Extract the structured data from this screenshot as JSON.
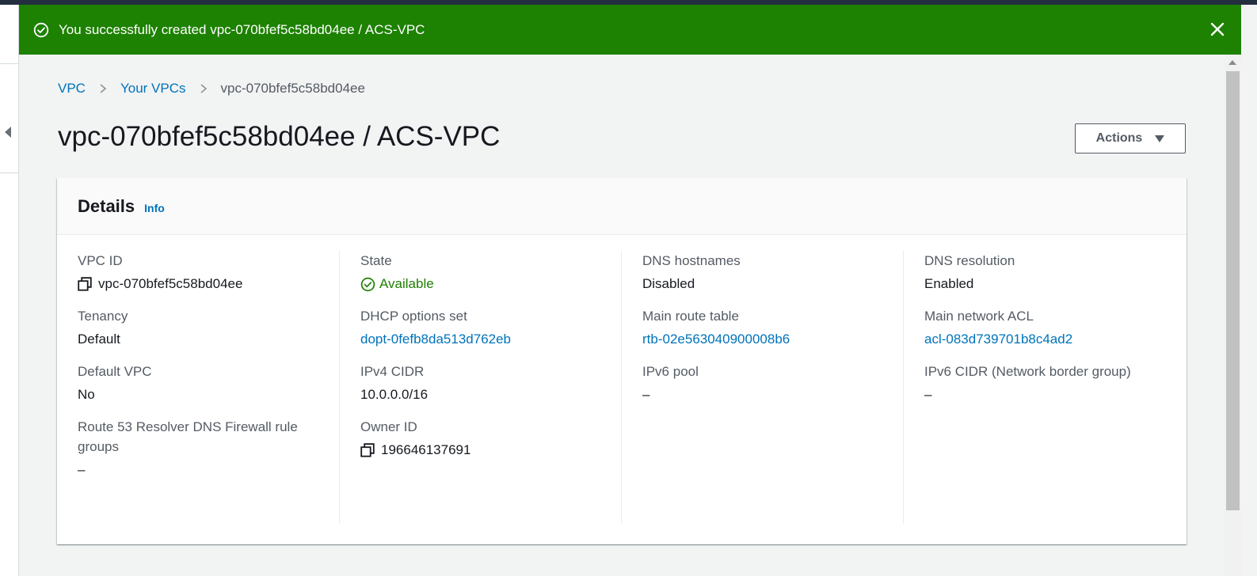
{
  "flash": {
    "message": "You successfully created vpc-070bfef5c58bd04ee / ACS-VPC"
  },
  "breadcrumb": {
    "items": [
      "VPC",
      "Your VPCs"
    ],
    "current": "vpc-070bfef5c58bd04ee"
  },
  "page": {
    "title": "vpc-070bfef5c58bd04ee / ACS-VPC",
    "actions_label": "Actions"
  },
  "details": {
    "title": "Details",
    "info_label": "Info",
    "columns": [
      [
        {
          "label": "VPC ID",
          "value": "vpc-070bfef5c58bd04ee"
        },
        {
          "label": "Tenancy",
          "value": "Default"
        },
        {
          "label": "Default VPC",
          "value": "No"
        },
        {
          "label": "Route 53 Resolver DNS Firewall rule groups",
          "value": "–"
        }
      ],
      [
        {
          "label": "State",
          "value": "Available"
        },
        {
          "label": "DHCP options set",
          "value": "dopt-0fefb8da513d762eb"
        },
        {
          "label": "IPv4 CIDR",
          "value": "10.0.0.0/16"
        },
        {
          "label": "Owner ID",
          "value": "196646137691"
        }
      ],
      [
        {
          "label": "DNS hostnames",
          "value": "Disabled"
        },
        {
          "label": "Main route table",
          "value": "rtb-02e563040900008b6"
        },
        {
          "label": "IPv6 pool",
          "value": "–"
        }
      ],
      [
        {
          "label": "DNS resolution",
          "value": "Enabled"
        },
        {
          "label": "Main network ACL",
          "value": "acl-083d739701b8c4ad2"
        },
        {
          "label": "IPv6 CIDR (Network border group)",
          "value": "–"
        }
      ]
    ]
  },
  "colors": {
    "success": "#1d8102",
    "link": "#0073bb",
    "header": "#232f3e"
  },
  "icons": [
    "status-ok-icon",
    "close-icon",
    "chevron-right-icon",
    "caret-down-icon",
    "copy-icon",
    "collapse-left-icon"
  ]
}
